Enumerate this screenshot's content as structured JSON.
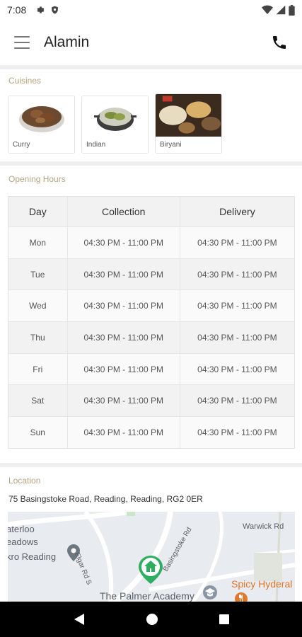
{
  "status_bar": {
    "time": "7:08"
  },
  "header": {
    "title": "Alamin"
  },
  "cuisines": {
    "section_title": "Cuisines",
    "items": [
      {
        "label": "Curry"
      },
      {
        "label": "Indian"
      },
      {
        "label": "Biryani"
      }
    ]
  },
  "opening_hours": {
    "section_title": "Opening Hours",
    "columns": [
      "Day",
      "Collection",
      "Delivery"
    ],
    "rows": [
      {
        "day": "Mon",
        "collection": "04:30 PM - 11:00 PM",
        "delivery": "04:30 PM - 11:00 PM"
      },
      {
        "day": "Tue",
        "collection": "04:30 PM - 11:00 PM",
        "delivery": "04:30 PM - 11:00 PM"
      },
      {
        "day": "Wed",
        "collection": "04:30 PM - 11:00 PM",
        "delivery": "04:30 PM - 11:00 PM"
      },
      {
        "day": "Thu",
        "collection": "04:30 PM - 11:00 PM",
        "delivery": "04:30 PM - 11:00 PM"
      },
      {
        "day": "Fri",
        "collection": "04:30 PM - 11:00 PM",
        "delivery": "04:30 PM - 11:00 PM"
      },
      {
        "day": "Sat",
        "collection": "04:30 PM - 11:00 PM",
        "delivery": "04:30 PM - 11:00 PM"
      },
      {
        "day": "Sun",
        "collection": "04:30 PM - 11:00 PM",
        "delivery": "04:30 PM - 11:00 PM"
      }
    ]
  },
  "location": {
    "section_title": "Location",
    "address": "75 Basingstoke Road, Reading, Reading, RG2 0ER",
    "map": {
      "labels": {
        "waterloo": "aterloo",
        "meadows": "eadows",
        "reading": "kro Reading",
        "elgar": "Elgar Rd S",
        "basingstoke": "Basingstoke Rd",
        "warwick": "Warwick Rd",
        "palmer": "The Palmer Academy",
        "spicy": "Spicy Hyderal"
      }
    }
  },
  "colors": {
    "section_title": "#b5a47e",
    "map_pin": "#2fae61",
    "restaurant_label": "#e2762a"
  }
}
